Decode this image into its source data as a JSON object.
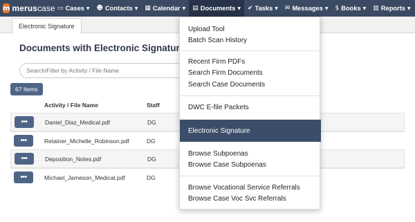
{
  "app": {
    "logo_letter": "m",
    "logo_name_bold": "merus",
    "logo_name_rest": "case"
  },
  "nav": [
    {
      "icon": "folder-icon",
      "glyph": "▭",
      "label": "Cases"
    },
    {
      "icon": "contacts-icon",
      "glyph": "☻",
      "label": "Contacts"
    },
    {
      "icon": "calendar-icon",
      "glyph": "▦",
      "label": "Calendar"
    },
    {
      "icon": "documents-icon",
      "glyph": "▤",
      "label": "Documents"
    },
    {
      "icon": "tasks-icon",
      "glyph": "✔",
      "label": "Tasks"
    },
    {
      "icon": "messages-icon",
      "glyph": "✉",
      "label": "Messages"
    },
    {
      "icon": "books-icon",
      "glyph": "$",
      "label": "Books"
    },
    {
      "icon": "reports-icon",
      "glyph": "▥",
      "label": "Reports"
    }
  ],
  "tab": {
    "label": "Electronic Signature"
  },
  "page": {
    "title": "Documents with Electronic Signature",
    "search_placeholder": "Search/Filter by Activity / File Name",
    "count": "67 Items",
    "columns": {
      "activity": "Activity / File Name",
      "staff": "Staff"
    },
    "rows": [
      {
        "file": "Daniel_Diaz_Medical.pdf",
        "staff": "DG"
      },
      {
        "file": "Retainer_Michelle_Robinson.pdf",
        "staff": "DG"
      },
      {
        "file": "Deposition_Notes.pdf",
        "staff": "DG"
      },
      {
        "file": "Michael_Jameson_Medical.pdf",
        "staff": "DG"
      }
    ],
    "row_button": "•••"
  },
  "dropdown": {
    "groups": [
      [
        "Upload Tool",
        "Batch Scan History"
      ],
      [
        "Recent Firm PDFs",
        "Search Firm Documents",
        "Search Case Documents"
      ],
      [
        "DWC E-file Packets"
      ],
      [
        "Electronic Signature"
      ],
      [
        "Browse Subpoenas",
        "Browse Case Subpoenas"
      ],
      [
        "Browse Vocational Service Referrals",
        "Browse Case Voc Svc Referrals"
      ]
    ],
    "active": "Electronic Signature"
  },
  "colors": {
    "nav_bg": "#3a4a63",
    "accent": "#4f6586",
    "active_item": "#3b4d68",
    "logo": "#e8772e"
  }
}
